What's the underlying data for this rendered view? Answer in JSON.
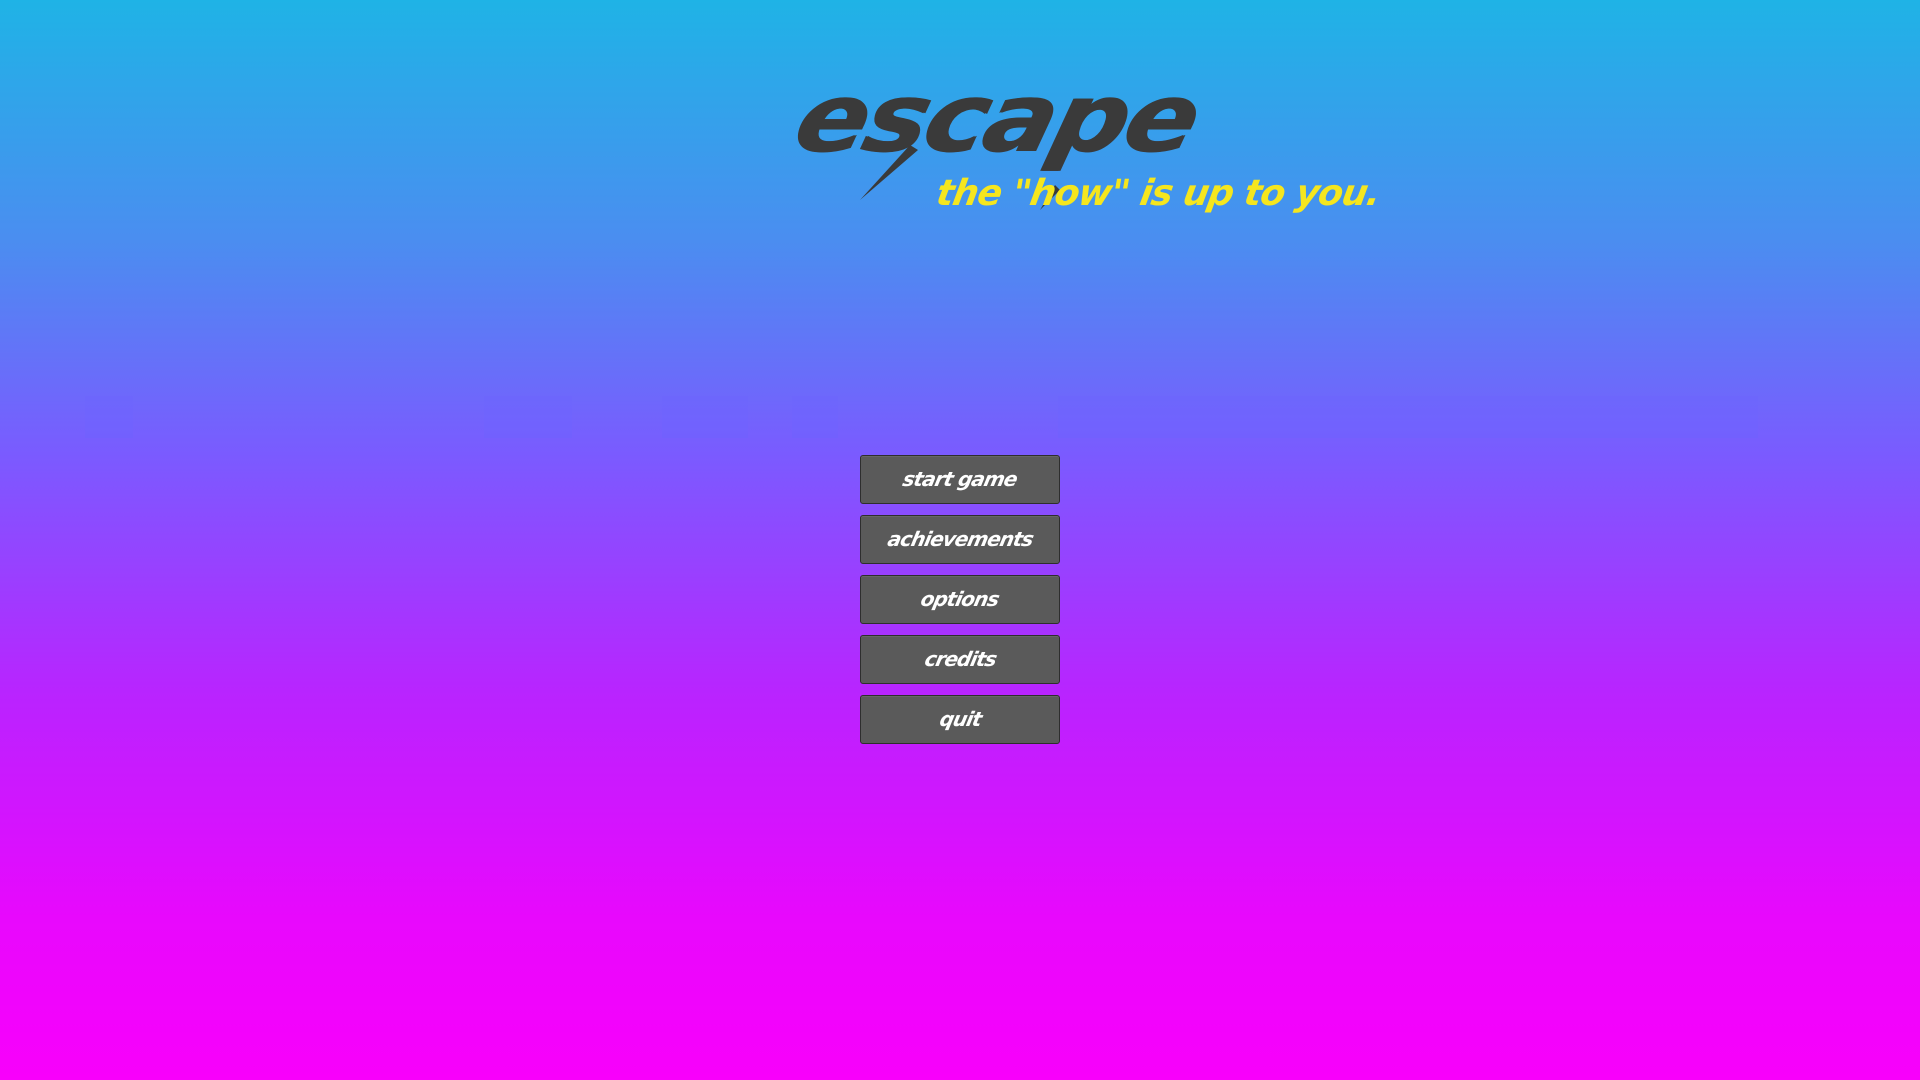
{
  "title": {
    "logo_text": "escape",
    "tagline": "the \"how\" is up to you."
  },
  "menu": {
    "items": [
      {
        "label": "start game"
      },
      {
        "label": "achievements"
      },
      {
        "label": "options"
      },
      {
        "label": "credits"
      },
      {
        "label": "quit"
      }
    ]
  },
  "colors": {
    "background_top": "#1fb3e6",
    "background_middle": "#7a5bff",
    "background_bottom": "#f800fb",
    "logo": "#3a3a3a",
    "tagline": "#f5e61e",
    "button_fill": "#5a5a5a",
    "button_text": "#ffffff"
  }
}
